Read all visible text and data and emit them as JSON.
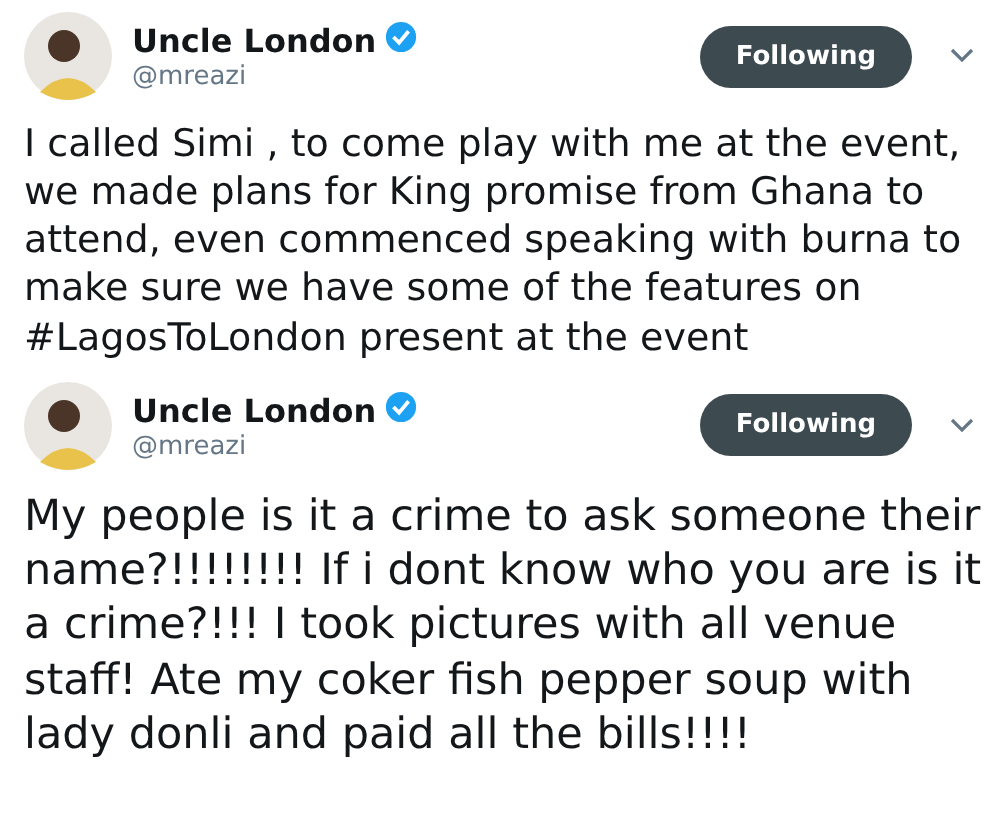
{
  "tweets": [
    {
      "author": "Uncle London",
      "handle": "@mreazi",
      "verified": true,
      "follow_button": "Following",
      "kind": "normal",
      "text": "I called Simi , to come play with me at the event, we made plans for King promise from Ghana to attend, even commenced speaking with burna to make sure we have some of the features on #LagosToLondon present at the event"
    },
    {
      "author": "Uncle London",
      "handle": "@mreazi",
      "verified": true,
      "follow_button": "Following",
      "kind": "large",
      "text": "My people is it a crime to ask someone their name?!!!!!!!! If i dont know who you are is it a crime?!!! I took pictures with all venue staff! Ate my coker fish pepper soup with lady donli and paid all the bills!!!!"
    }
  ]
}
